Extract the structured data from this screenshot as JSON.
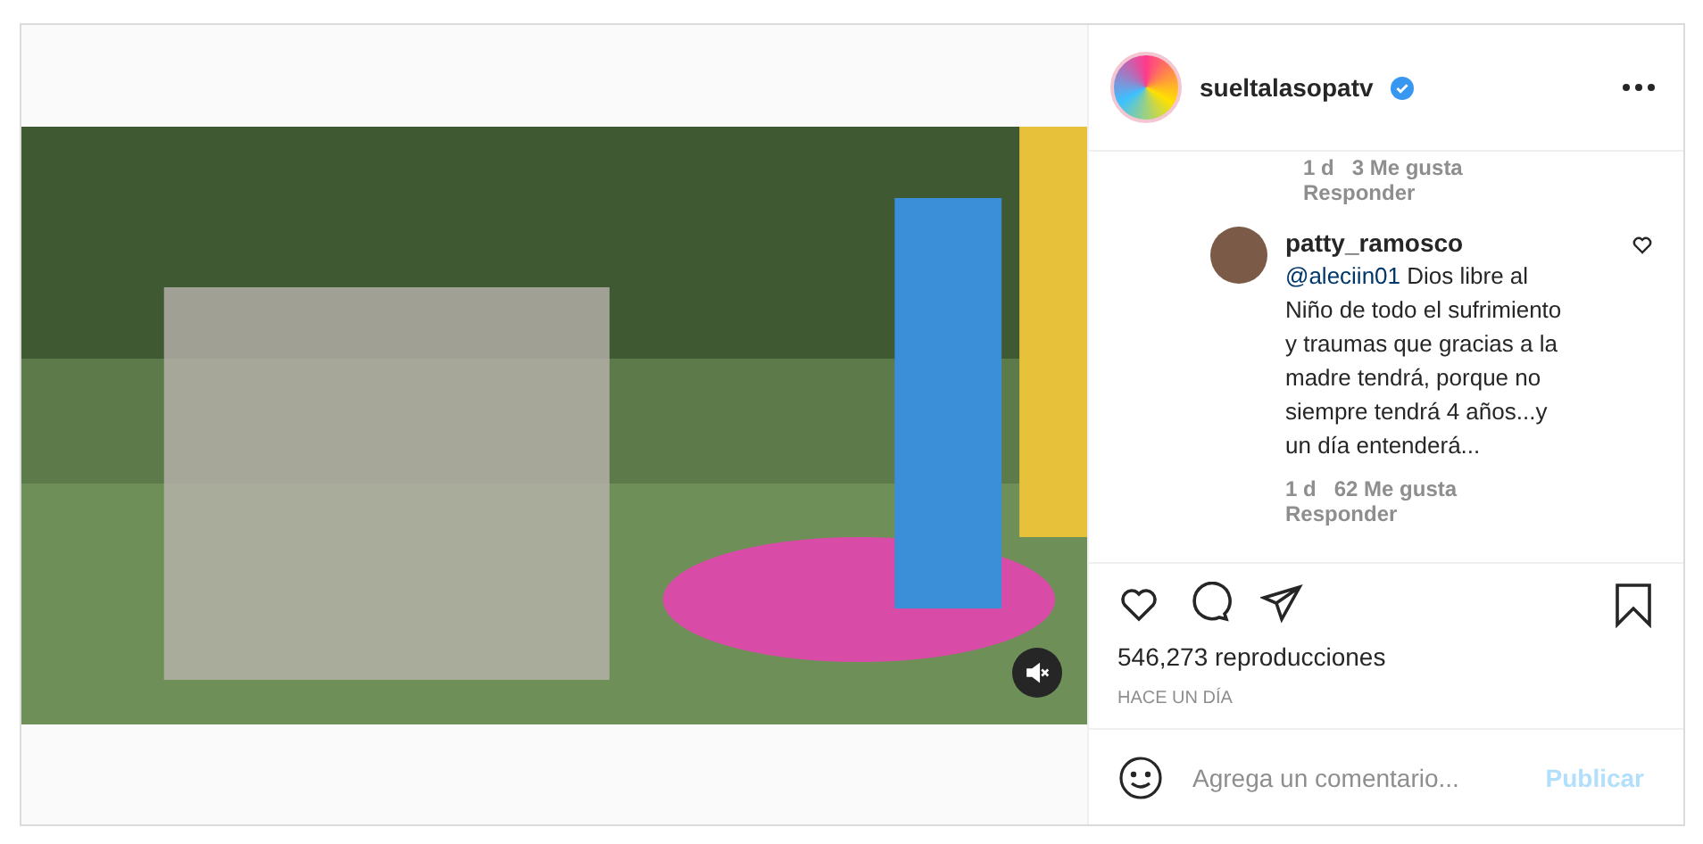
{
  "post": {
    "username": "sueltalasopatv",
    "verified": true
  },
  "comments": [
    {
      "time": "1 d",
      "likes": "3 Me gusta",
      "reply": "Responder"
    },
    {
      "author": "patty_ramosco",
      "mention": "@aleciin01",
      "text": "Dios libre al Niño de todo el sufrimiento y traumas que gracias a la madre tendrá, porque no siempre tendrá 4 años...y un día entenderá...",
      "time": "1 d",
      "likes": "62 Me gusta",
      "reply": "Responder"
    }
  ],
  "video": {
    "muted": true
  },
  "stats": {
    "views": "546,273 reproducciones",
    "date": "HACE UN DÍA"
  },
  "composer": {
    "placeholder": "Agrega un comentario...",
    "submit": "Publicar",
    "submit_disabled": true
  }
}
